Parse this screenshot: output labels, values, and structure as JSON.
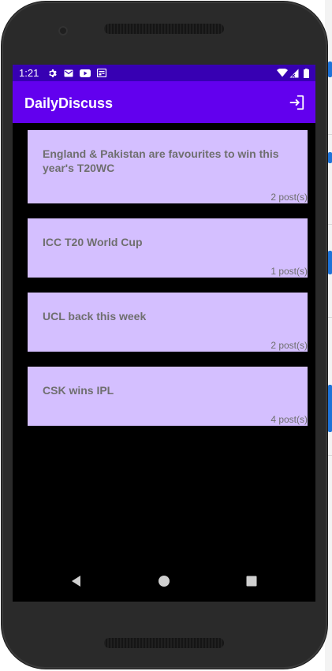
{
  "status_bar": {
    "time": "1:21",
    "icons": [
      "settings-icon",
      "gmail-icon",
      "youtube-icon",
      "news-icon",
      "wifi-icon",
      "signal-icon",
      "battery-icon"
    ]
  },
  "app_bar": {
    "title": "DailyDiscuss",
    "action_icon": "logout-icon"
  },
  "topics": [
    {
      "title": "England & Pakistan are favourites to win this year's T20WC",
      "post_count": "2 post(s)"
    },
    {
      "title": "ICC T20 World Cup",
      "post_count": "1 post(s)"
    },
    {
      "title": "UCL back this week",
      "post_count": "2 post(s)"
    },
    {
      "title": "CSK wins IPL",
      "post_count": "4 post(s)"
    }
  ],
  "nav_bar": {
    "buttons": [
      "back-icon",
      "home-icon",
      "recents-icon"
    ]
  },
  "colors": {
    "status_bar": "#3700b3",
    "app_bar": "#6200ee",
    "card": "#d4bfff",
    "card_text": "#6f6f6f",
    "screen_bg": "#000000"
  }
}
